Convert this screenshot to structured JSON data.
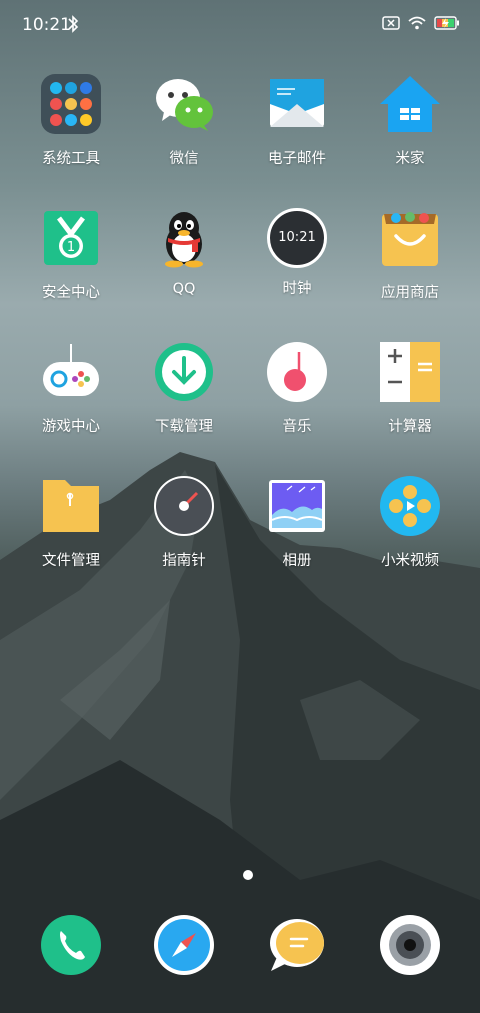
{
  "status": {
    "time": "10:21"
  },
  "apps": [
    {
      "name": "系统工具",
      "id": "system-tools"
    },
    {
      "name": "微信",
      "id": "wechat"
    },
    {
      "name": "电子邮件",
      "id": "email"
    },
    {
      "name": "米家",
      "id": "mijia"
    },
    {
      "name": "安全中心",
      "id": "security-center"
    },
    {
      "name": "QQ",
      "id": "qq"
    },
    {
      "name": "时钟",
      "id": "clock",
      "clock_text": "10:21"
    },
    {
      "name": "应用商店",
      "id": "app-store"
    },
    {
      "name": "游戏中心",
      "id": "game-center"
    },
    {
      "name": "下载管理",
      "id": "download-manager"
    },
    {
      "name": "音乐",
      "id": "music"
    },
    {
      "name": "计算器",
      "id": "calculator"
    },
    {
      "name": "文件管理",
      "id": "file-manager"
    },
    {
      "name": "指南针",
      "id": "compass"
    },
    {
      "name": "相册",
      "id": "gallery"
    },
    {
      "name": "小米视频",
      "id": "mi-video"
    }
  ],
  "dock": [
    "phone",
    "browser",
    "messages",
    "camera"
  ],
  "colors": {
    "accent_green": "#1fc08a",
    "store_yellow": "#f6c350",
    "mail_blue": "#1fa3e0"
  }
}
